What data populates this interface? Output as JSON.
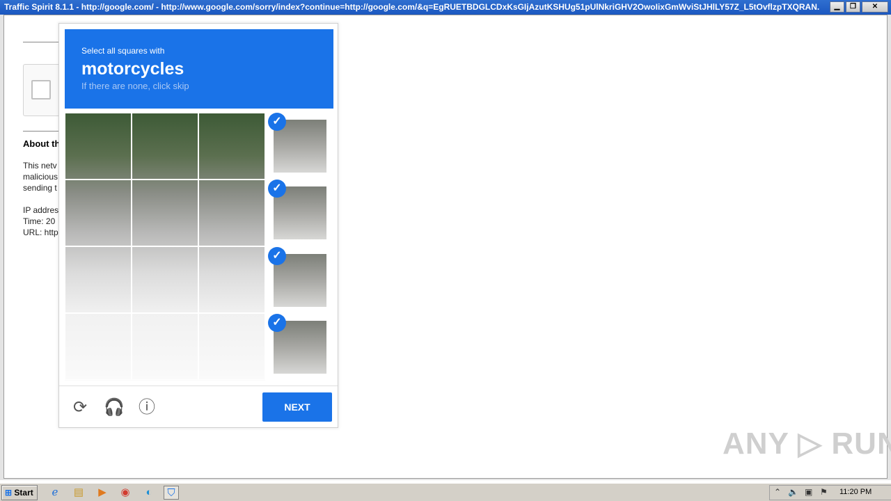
{
  "window": {
    "title": "Traffic Spirit 8.1.1 - http://google.com/ - http://www.google.com/sorry/index?continue=http://google.com/&q=EgRUETBDGLCDxKsGIjAzutKSHUg51pUlNkriGHV2OwoIixGmWviStJHlLY57Z_L5tOvflzpTXQRAN...",
    "controls": {
      "minimize": "▁",
      "restore": "❐",
      "close": "✕"
    }
  },
  "background_page": {
    "about_heading": "About th",
    "lines": [
      "This netv",
      "malicious",
      "sending t",
      "",
      "IP addres",
      "Time: 20",
      "URL: http"
    ]
  },
  "captcha": {
    "instruction_small": "Select all squares with",
    "target": "motorcycles",
    "hint": "If there are none, click skip",
    "selected_count": 4,
    "selected_check": "✓",
    "footer": {
      "reload_icon": "reload-icon",
      "audio_icon": "headphones-icon",
      "info_icon": "info-icon",
      "reload_glyph": "⟳",
      "audio_glyph": "🎧",
      "info_glyph": "ⓘ",
      "next_label": "NEXT"
    },
    "colors": {
      "accent": "#1a73e8"
    }
  },
  "watermark": "ANY ▷ RUN",
  "taskbar": {
    "start_label": "Start",
    "apps": [
      {
        "name": "ie-icon",
        "glyph": "ℯ"
      },
      {
        "name": "explorer-icon",
        "glyph": "▤"
      },
      {
        "name": "media-player-icon",
        "glyph": "▶"
      },
      {
        "name": "chrome-icon",
        "glyph": "◉"
      },
      {
        "name": "edge-icon",
        "glyph": "◐"
      },
      {
        "name": "traffic-spirit-icon",
        "glyph": "⛉"
      }
    ],
    "tray": {
      "arrow_glyph": "⌃",
      "volume_glyph": "🔈",
      "network_glyph": "▣",
      "flag_glyph": "⚑",
      "clock": "11:20 PM"
    }
  }
}
